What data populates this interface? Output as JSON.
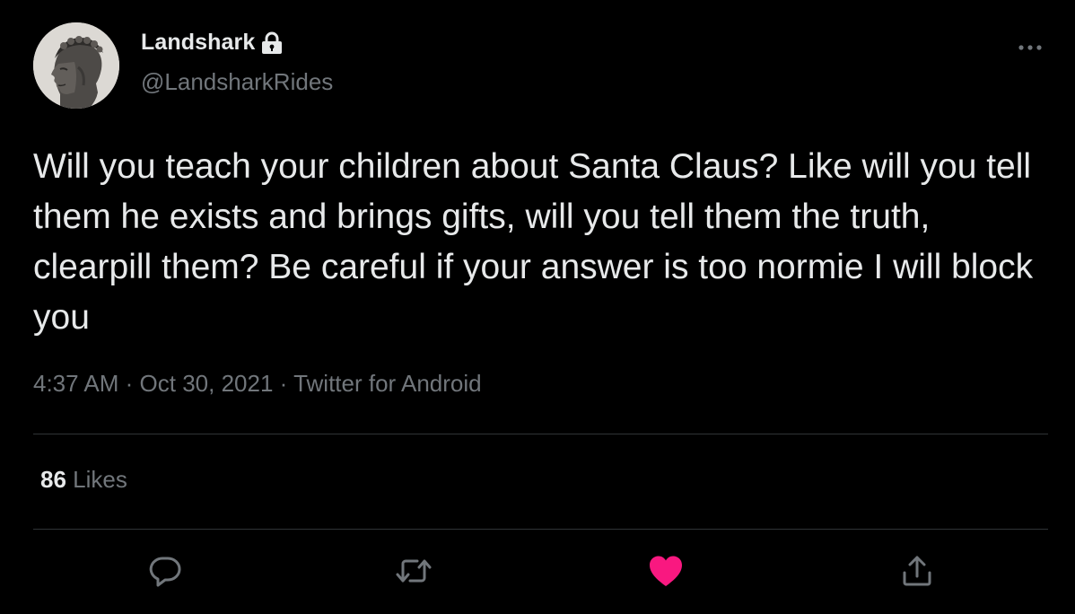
{
  "author": {
    "display_name": "Landshark",
    "handle": "@LandsharkRides",
    "protected_icon": "lock-icon",
    "avatar_icon": "helmeted-statue-head-avatar"
  },
  "tweet": {
    "text": "Will you teach your children about Santa Claus? Like will you tell them he exists and brings gifts, will you tell them the truth, clearpill them? Be careful if your answer is too normie I will block you",
    "time": "4:37 AM",
    "date": "Oct 30, 2021",
    "source": "Twitter for Android",
    "separator": "·"
  },
  "stats": {
    "likes_count": "86",
    "likes_label": "Likes"
  },
  "actions": [
    {
      "name": "reply",
      "icon": "speech-bubble-icon"
    },
    {
      "name": "retweet",
      "icon": "retweet-arrows-icon"
    },
    {
      "name": "like",
      "icon": "heart-icon",
      "active": true
    },
    {
      "name": "share",
      "icon": "share-upload-icon"
    }
  ],
  "colors": {
    "background": "#000000",
    "primary_text": "#e7e9ea",
    "secondary_text": "#71767b",
    "divider": "#2f3336",
    "like_active": "#f91880"
  }
}
